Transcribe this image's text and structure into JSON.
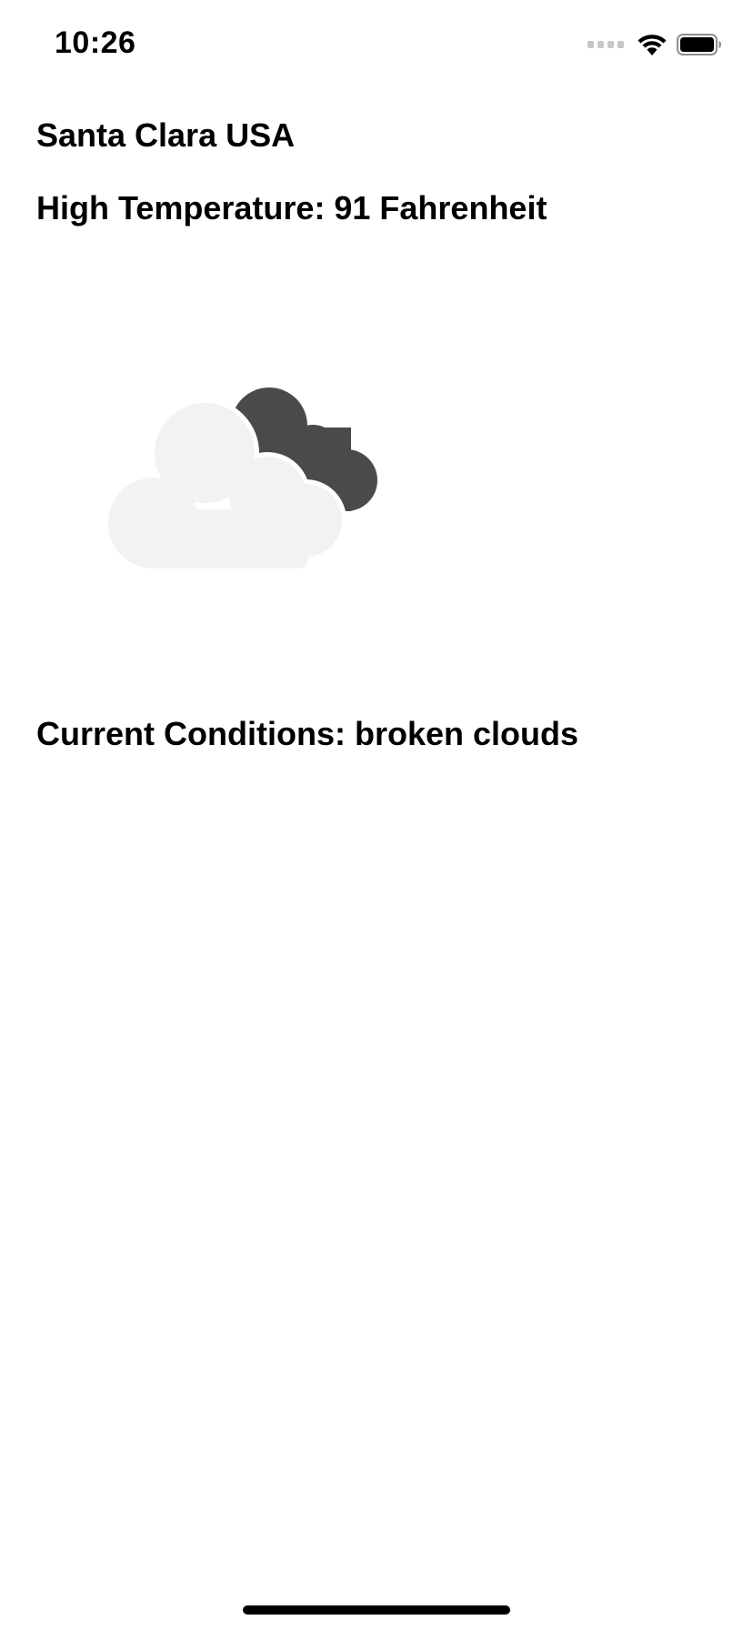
{
  "status_bar": {
    "time": "10:26",
    "icons": [
      "cellular-signal-icon",
      "wifi-icon",
      "battery-icon"
    ]
  },
  "weather": {
    "city": "Santa Clara USA",
    "high_temperature": "High Temperature: 91 Fahrenheit",
    "conditions": "Current Conditions: broken clouds",
    "icon": "broken-clouds-icon"
  },
  "colors": {
    "background": "#ffffff",
    "text": "#000000",
    "cloud_light": "#f2f2f0",
    "cloud_dark": "#4a4a4c",
    "signal_inactive": "#c7c7c7"
  }
}
